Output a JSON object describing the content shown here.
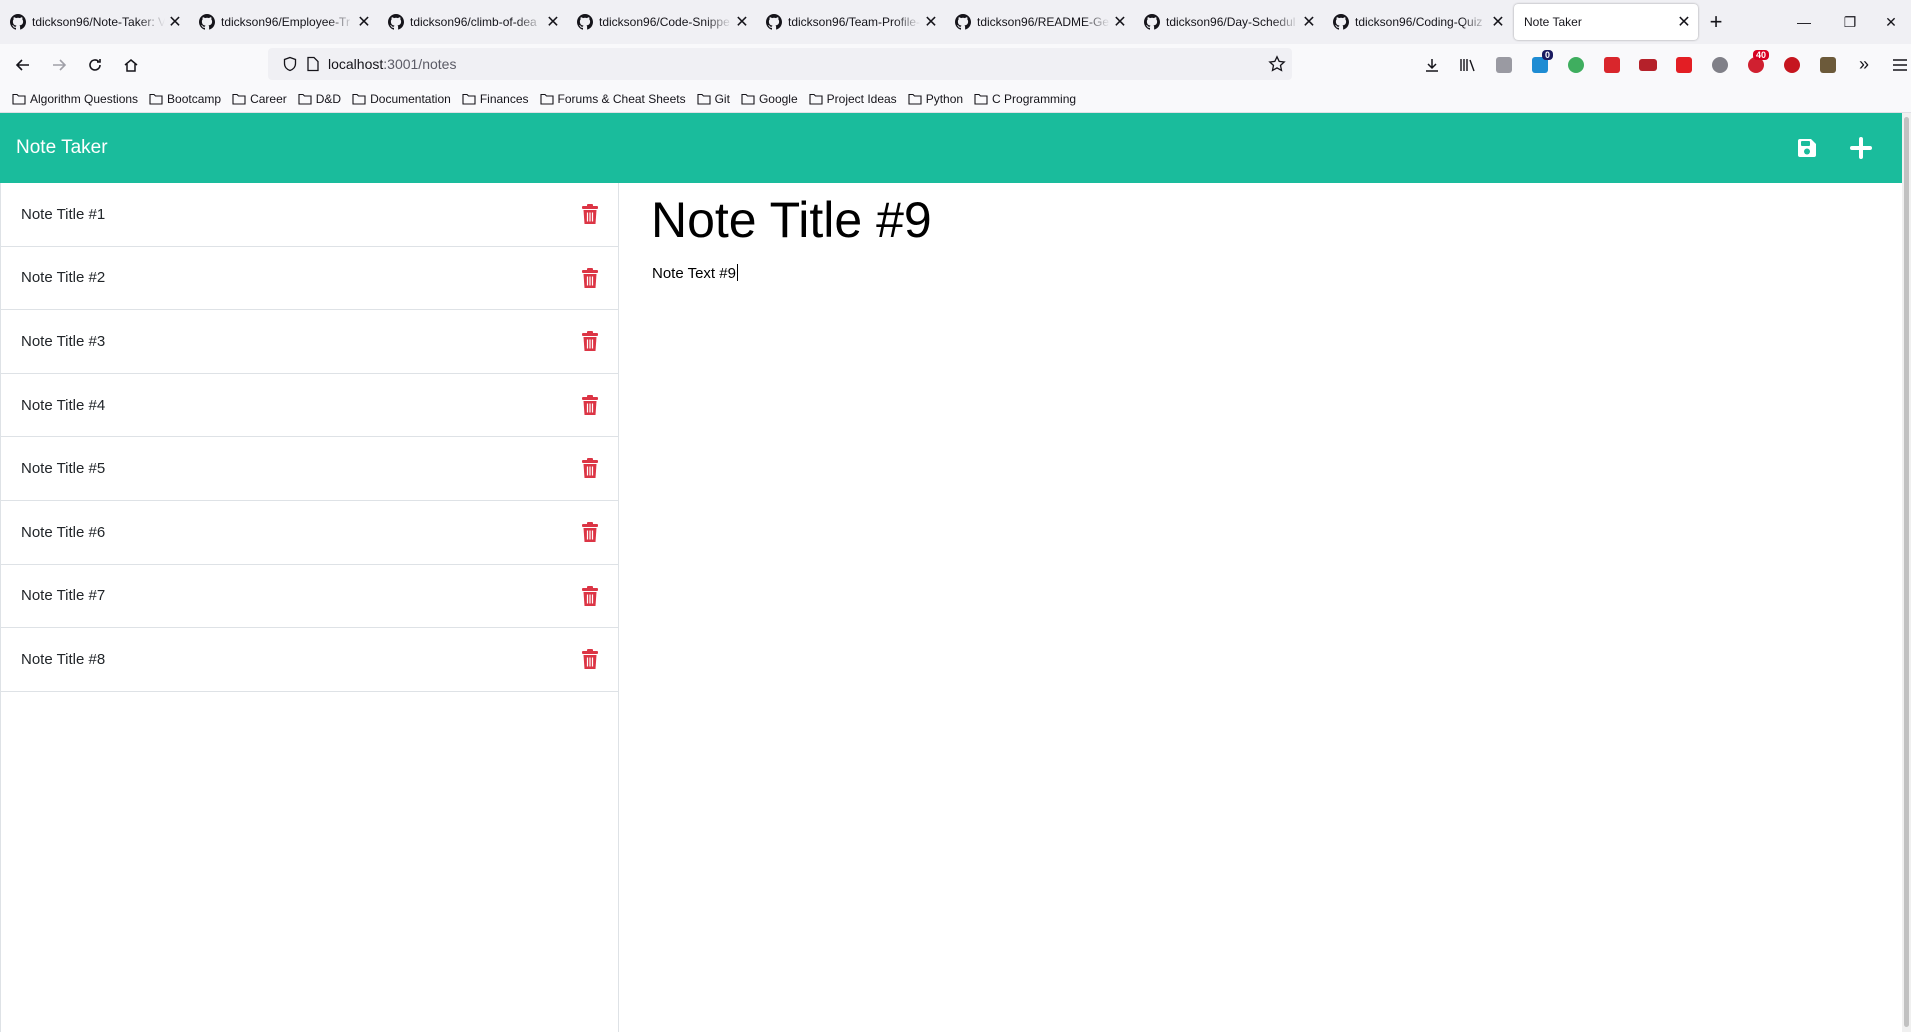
{
  "browser": {
    "tabs": [
      {
        "label": "tdickson96/Note-Taker: V",
        "active": false
      },
      {
        "label": "tdickson96/Employee-Tr",
        "active": false
      },
      {
        "label": "tdickson96/climb-of-dea",
        "active": false
      },
      {
        "label": "tdickson96/Code-Snippe",
        "active": false
      },
      {
        "label": "tdickson96/Team-Profile-",
        "active": false
      },
      {
        "label": "tdickson96/README-Gen",
        "active": false
      },
      {
        "label": "tdickson96/Day-Schedul",
        "active": false
      },
      {
        "label": "tdickson96/Coding-Quiz",
        "active": false
      },
      {
        "label": "Note Taker",
        "active": true
      }
    ],
    "url_host": "localhost",
    "url_rest": ":3001/notes",
    "extension_badges": {
      "ext1": "0",
      "ext9": "40"
    },
    "bookmarks": [
      "Algorithm Questions",
      "Bootcamp",
      "Career",
      "D&D",
      "Documentation",
      "Finances",
      "Forums & Cheat Sheets",
      "Git",
      "Google",
      "Project Ideas",
      "Python",
      "C Programming"
    ]
  },
  "app": {
    "title": "Note Taker",
    "accent_color": "#1abc9c",
    "delete_color": "#dc3545",
    "notes": [
      {
        "title": "Note Title #1"
      },
      {
        "title": "Note Title #2"
      },
      {
        "title": "Note Title #3"
      },
      {
        "title": "Note Title #4"
      },
      {
        "title": "Note Title #5"
      },
      {
        "title": "Note Title #6"
      },
      {
        "title": "Note Title #7"
      },
      {
        "title": "Note Title #8"
      }
    ],
    "active_note": {
      "title": "Note Title #9",
      "text": "Note Text #9"
    },
    "icons": {
      "save": "save-icon",
      "new": "plus-icon",
      "delete": "trash-icon"
    }
  }
}
